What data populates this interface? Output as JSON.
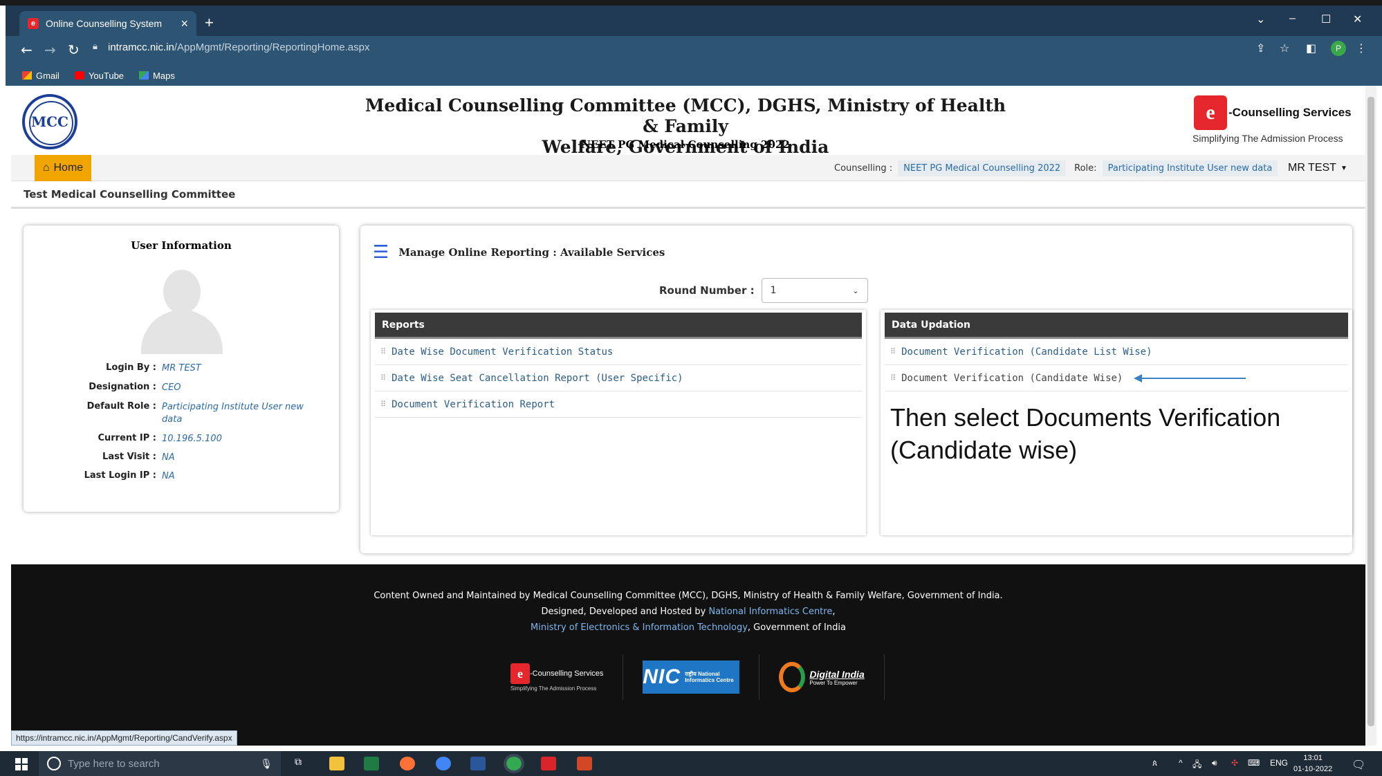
{
  "browser": {
    "tab_title": "Online Counselling System",
    "tab_close": "×",
    "new_tab": "+",
    "url_host": "intramcc.nic.in",
    "url_path": "/AppMgmt/Reporting/ReportingHome.aspx",
    "bookmarks": [
      "Gmail",
      "YouTube",
      "Maps"
    ],
    "profile_initial": "P",
    "status_url": "https://intramcc.nic.in/AppMgmt/Reporting/CandVerify.aspx"
  },
  "header": {
    "logo_text": "MCC",
    "title_line1": "Medical Counselling Committee (MCC), DGHS, Ministry of Health & Family",
    "title_line2": "Welfare, Government of India",
    "subtitle": "NEET PG Medical Counselling 2022",
    "brand_letter": "e",
    "brand_name": "-Counselling Services",
    "brand_tagline": "Simplifying The Admission Process"
  },
  "navbar": {
    "home_label": "Home",
    "counselling_label": "Counselling :",
    "counselling_value": "NEET PG Medical Counselling 2022",
    "role_label": "Role:",
    "role_value": "Participating Institute User new data",
    "user_name": "MR TEST"
  },
  "org_name": "Test Medical Counselling Committee",
  "user_info": {
    "heading": "User Information",
    "fields": [
      {
        "label": "Login By :",
        "value": "MR TEST"
      },
      {
        "label": "Designation :",
        "value": "CEO"
      },
      {
        "label": "Default Role :",
        "value": "Participating Institute User new data"
      },
      {
        "label": "Current IP :",
        "value": "10.196.5.100"
      },
      {
        "label": "Last Visit :",
        "value": "NA"
      },
      {
        "label": "Last Login IP :",
        "value": "NA"
      }
    ]
  },
  "manage": {
    "heading": "Manage Online Reporting : Available Services",
    "round_label": "Round Number :",
    "round_value": "1",
    "reports": {
      "title": "Reports",
      "items": [
        "Date Wise Document Verification Status",
        "Date Wise Seat Cancellation Report (User Specific)",
        "Document Verification Report"
      ]
    },
    "data_updation": {
      "title": "Data Updation",
      "items": [
        "Document Verification (Candidate List Wise)",
        "Document Verification (Candidate Wise)"
      ]
    },
    "annotation_line1": "Then select Documents Verification",
    "annotation_line2": "(Candidate wise)"
  },
  "footer": {
    "line1": "Content Owned and Maintained by Medical Counselling Committee (MCC), DGHS, Ministry of Health & Family Welfare, Government of India.",
    "line2_pre": "Designed, Developed and Hosted by ",
    "line2_link": "National Informatics Centre",
    "line2_post": ",",
    "line3_link": "Ministry of Electronics & Information Technology",
    "line3_post": ", Government of India",
    "ec_name": "-Counselling Services",
    "ec_tagline": "Simplifying The Admission Process",
    "nic_big": "NIC",
    "nic_small": "राष्ट्रीय National Informatics Centre",
    "di_name": "Digital India",
    "di_tagline": "Power To Empower"
  },
  "taskbar": {
    "search_placeholder": "Type here to search",
    "lang": "ENG",
    "time": "13:01",
    "date": "01-10-2022"
  }
}
